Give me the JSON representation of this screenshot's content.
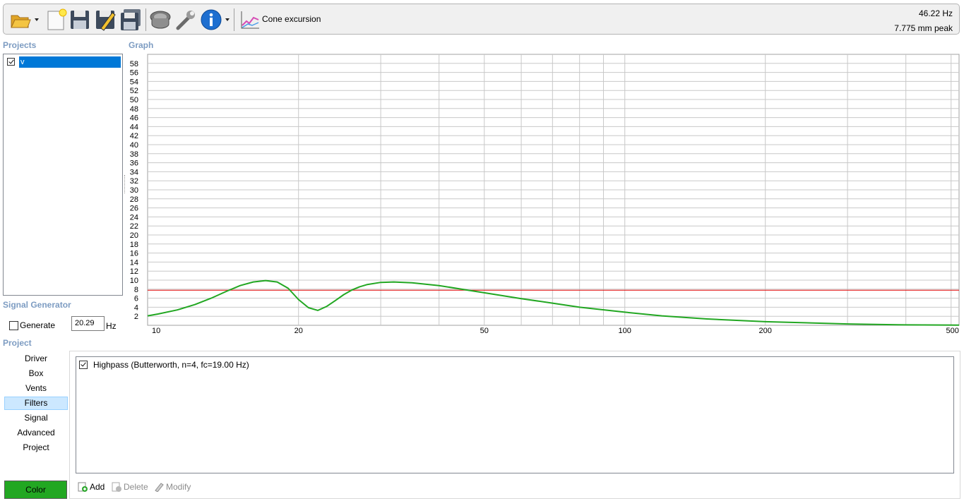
{
  "toolbar": {
    "buttons": [
      {
        "name": "open-folder-icon",
        "has_dropdown": true
      },
      {
        "name": "new-project-icon"
      },
      {
        "name": "save-icon"
      },
      {
        "name": "save-as-icon"
      },
      {
        "name": "save-all-icon"
      },
      {
        "name": "driver-icon"
      },
      {
        "name": "wrench-icon"
      },
      {
        "name": "info-icon",
        "has_dropdown": true
      }
    ],
    "mode_icon": "graph-icon",
    "mode_label": "Cone excursion",
    "readout_frequency": "46.22 Hz",
    "readout_value": "7.775 mm peak"
  },
  "projects": {
    "title": "Projects",
    "items": [
      {
        "label": "v",
        "checked": true,
        "selected": true
      }
    ]
  },
  "graph": {
    "title": "Graph"
  },
  "chart_data": {
    "type": "line",
    "x_scale": "log",
    "xlim": [
      9.5,
      520
    ],
    "ylim": [
      0,
      60
    ],
    "x_tick_labels": [
      "10",
      "20",
      "50",
      "100",
      "200",
      "500"
    ],
    "x_gridlines": [
      20,
      30,
      40,
      50,
      60,
      70,
      80,
      90,
      100,
      200,
      300,
      400,
      500
    ],
    "y_tick_labels": [
      "2",
      "4",
      "6",
      "8",
      "10",
      "12",
      "14",
      "16",
      "18",
      "20",
      "22",
      "24",
      "26",
      "28",
      "30",
      "32",
      "34",
      "36",
      "38",
      "40",
      "42",
      "44",
      "46",
      "48",
      "50",
      "52",
      "54",
      "56",
      "58"
    ],
    "grid": true,
    "reference_line": {
      "y": 7.775,
      "color": "#e00000"
    },
    "series": [
      {
        "color": "#22a722",
        "x": [
          9.5,
          10,
          11,
          12,
          13,
          14,
          15,
          16,
          17,
          18,
          19,
          20,
          21,
          22,
          23,
          24,
          25,
          26,
          27,
          28,
          30,
          32,
          35,
          40,
          46,
          50,
          60,
          70,
          80,
          100,
          120,
          150,
          200,
          300,
          400,
          520
        ],
        "y": [
          2.1,
          2.5,
          3.4,
          4.6,
          6.0,
          7.5,
          8.8,
          9.6,
          9.9,
          9.6,
          8.2,
          5.7,
          3.9,
          3.3,
          4.2,
          5.5,
          6.8,
          7.8,
          8.5,
          9.0,
          9.5,
          9.6,
          9.4,
          8.8,
          7.8,
          7.2,
          5.9,
          4.9,
          4.0,
          2.9,
          2.1,
          1.4,
          0.8,
          0.3,
          0.1,
          0.05
        ]
      }
    ]
  },
  "signal_generator": {
    "title": "Signal Generator",
    "generate_label": "Generate",
    "generate_checked": false,
    "frequency_value": "20.29",
    "unit": "Hz"
  },
  "project": {
    "title": "Project",
    "nav": [
      "Driver",
      "Box",
      "Vents",
      "Filters",
      "Signal",
      "Advanced",
      "Project"
    ],
    "active_nav": "Filters",
    "color_button": "Color"
  },
  "filters": {
    "items": [
      {
        "label": "Highpass (Butterworth, n=4, fc=19.00 Hz)",
        "checked": true
      }
    ],
    "actions": {
      "add": "Add",
      "delete": "Delete",
      "modify": "Modify"
    }
  }
}
